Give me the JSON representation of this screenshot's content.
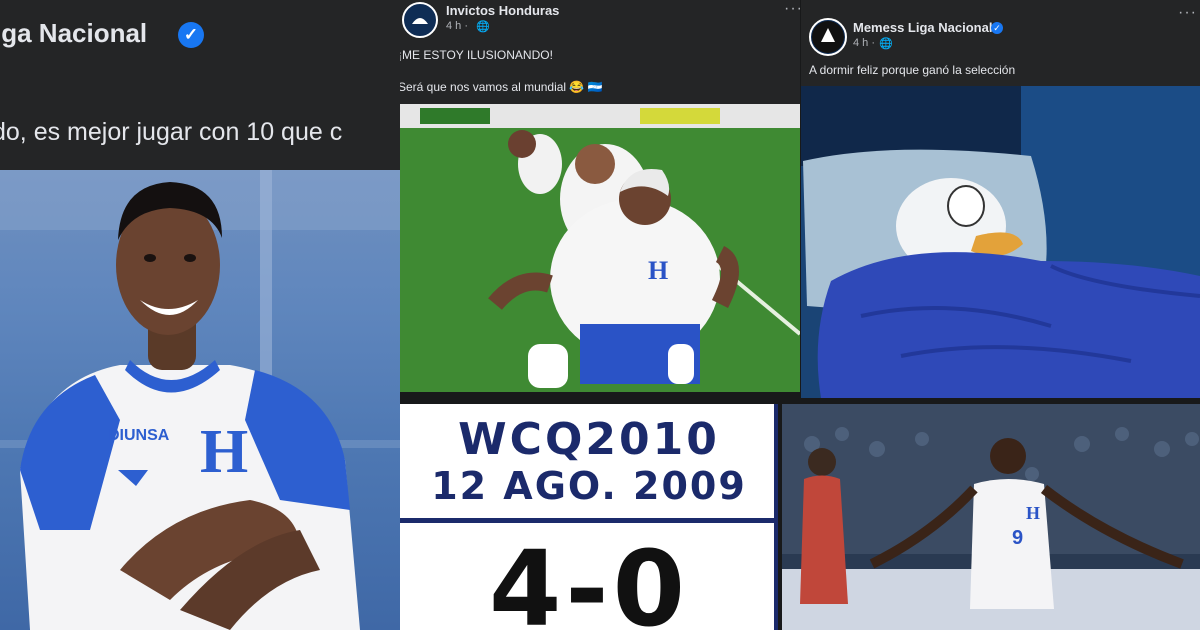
{
  "left_post": {
    "page_name": "iga Nacional",
    "post_text": "do, es mejor jugar con 10 que c"
  },
  "mid_post": {
    "page_name": "Invictos Honduras",
    "time": "4 h ·",
    "line1": "¡ME ESTOY ILUSIONANDO!",
    "line2": "Será que nos vamos al mundial 😂 🇭🇳"
  },
  "right_post": {
    "page_name": "Memess Liga Nacional",
    "time": "4 h ·",
    "line1": "A dormir feliz porque ganó la selección"
  },
  "score_card": {
    "title": "WCQ2010",
    "date": "12 AGO. 2009",
    "score": "4-0"
  },
  "jersey": {
    "sponsor": "DIUNSA",
    "crest_letter": "H",
    "player_number": "9"
  },
  "colors": {
    "fb_dark": "#242526",
    "verified_blue": "#1877f2",
    "honduras_blue": "#1b2a6b"
  }
}
